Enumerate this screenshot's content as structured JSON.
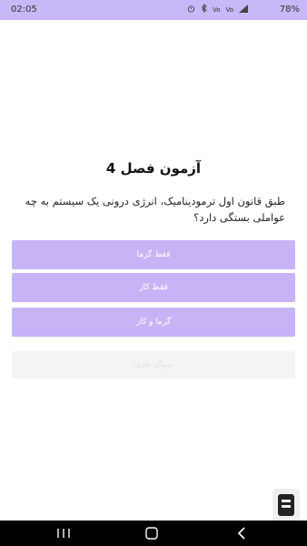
{
  "status_bar": {
    "time": "02:05",
    "battery": "78%",
    "icons": [
      "alarm-icon",
      "bluetooth-icon",
      "volte-icon",
      "volte-icon",
      "signal-icon"
    ]
  },
  "quiz": {
    "title": "آزمون فصل 4",
    "question": "طبق قانون اول ترمودینامیک، انرژی درونی یک سیستم به چه عواملی بستگی دارد؟",
    "options": [
      "فقط گرما",
      "فقط کار",
      "گرما و کار"
    ],
    "next_button": "سوال بعدی"
  },
  "colors": {
    "accent": "#c7b4f7",
    "status_bar": "#c9b8f7",
    "nav_bar": "#000000"
  }
}
